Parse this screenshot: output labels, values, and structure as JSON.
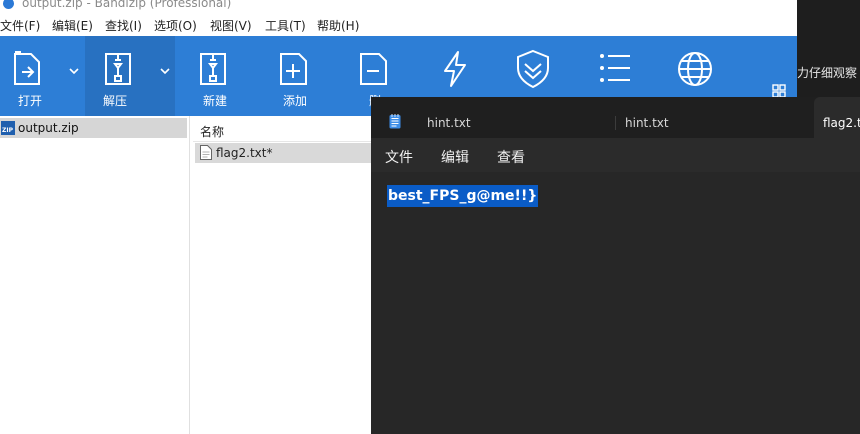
{
  "bandizip": {
    "window_title": "output.zip - Bandizip (Professional)",
    "menu": [
      "文件(F)",
      "编辑(E)",
      "查找(I)",
      "选项(O)",
      "视图(V)",
      "工具(T)",
      "帮助(H)"
    ],
    "toolbar": {
      "open": "打开",
      "extract": "解压",
      "new": "新建",
      "add": "添加",
      "delete": "删"
    },
    "tree": {
      "archive_name": "output.zip",
      "zip_badge": "ZIP"
    },
    "list": {
      "name_header": "名称",
      "files": [
        "flag2.txt*"
      ]
    },
    "background_text": "力仔细观察"
  },
  "notepad": {
    "tabs": [
      "hint.txt",
      "hint.txt",
      "flag2.t"
    ],
    "menu": [
      "文件",
      "编辑",
      "查看"
    ],
    "selected_text": "best_FPS_g@me!!}"
  },
  "colors": {
    "toolbar_blue": "#2d7ed6",
    "selection_blue": "#0a5cc7",
    "notepad_bg": "#272727"
  }
}
